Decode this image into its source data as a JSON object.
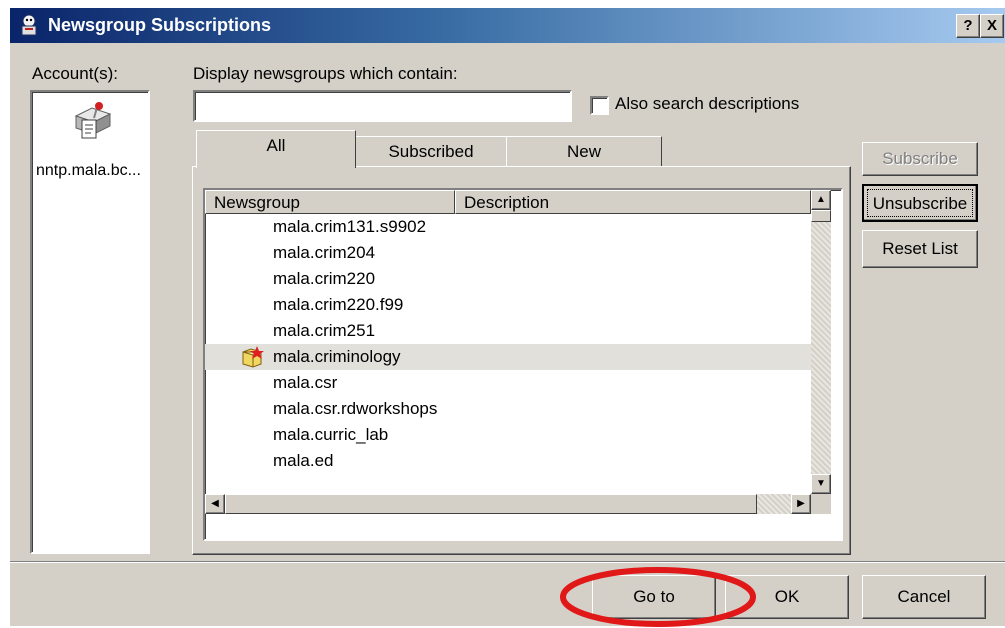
{
  "window": {
    "title": "Newsgroup Subscriptions",
    "help_button": "?",
    "close_button": "X",
    "title_icon": "newsgroup-app-icon"
  },
  "accounts": {
    "label": "Account(s):",
    "items": [
      {
        "name": "nntp.mala.bc...",
        "icon": "news-server-icon"
      }
    ]
  },
  "search": {
    "label": "Display newsgroups which contain:",
    "value": "",
    "also_search_descriptions_label": "Also search descriptions",
    "also_search_descriptions_checked": false
  },
  "tabs": [
    {
      "label": "All",
      "active": true
    },
    {
      "label": "Subscribed",
      "active": false
    },
    {
      "label": "New",
      "active": false
    }
  ],
  "list": {
    "columns": [
      "Newsgroup",
      "Description"
    ],
    "rows": [
      {
        "name": "mala.crim131.s9902",
        "subscribed": false,
        "selected": false
      },
      {
        "name": "mala.crim204",
        "subscribed": false,
        "selected": false
      },
      {
        "name": "mala.crim220",
        "subscribed": false,
        "selected": false
      },
      {
        "name": "mala.crim220.f99",
        "subscribed": false,
        "selected": false
      },
      {
        "name": "mala.crim251",
        "subscribed": false,
        "selected": false
      },
      {
        "name": "mala.criminology",
        "subscribed": true,
        "selected": true
      },
      {
        "name": "mala.csr",
        "subscribed": false,
        "selected": false
      },
      {
        "name": "mala.csr.rdworkshops",
        "subscribed": false,
        "selected": false
      },
      {
        "name": "mala.curric_lab",
        "subscribed": false,
        "selected": false
      },
      {
        "name": "mala.ed",
        "subscribed": false,
        "selected": false
      }
    ]
  },
  "side_buttons": {
    "subscribe": "Subscribe",
    "unsubscribe": "Unsubscribe",
    "reset_list": "Reset List"
  },
  "bottom_buttons": {
    "goto": "Go to",
    "ok": "OK",
    "cancel": "Cancel"
  },
  "colors": {
    "title_gradient_start": "#0a246a",
    "title_gradient_end": "#a6caf0",
    "dialog_face": "#d4d0c8",
    "annotation_red": "#e01818"
  }
}
